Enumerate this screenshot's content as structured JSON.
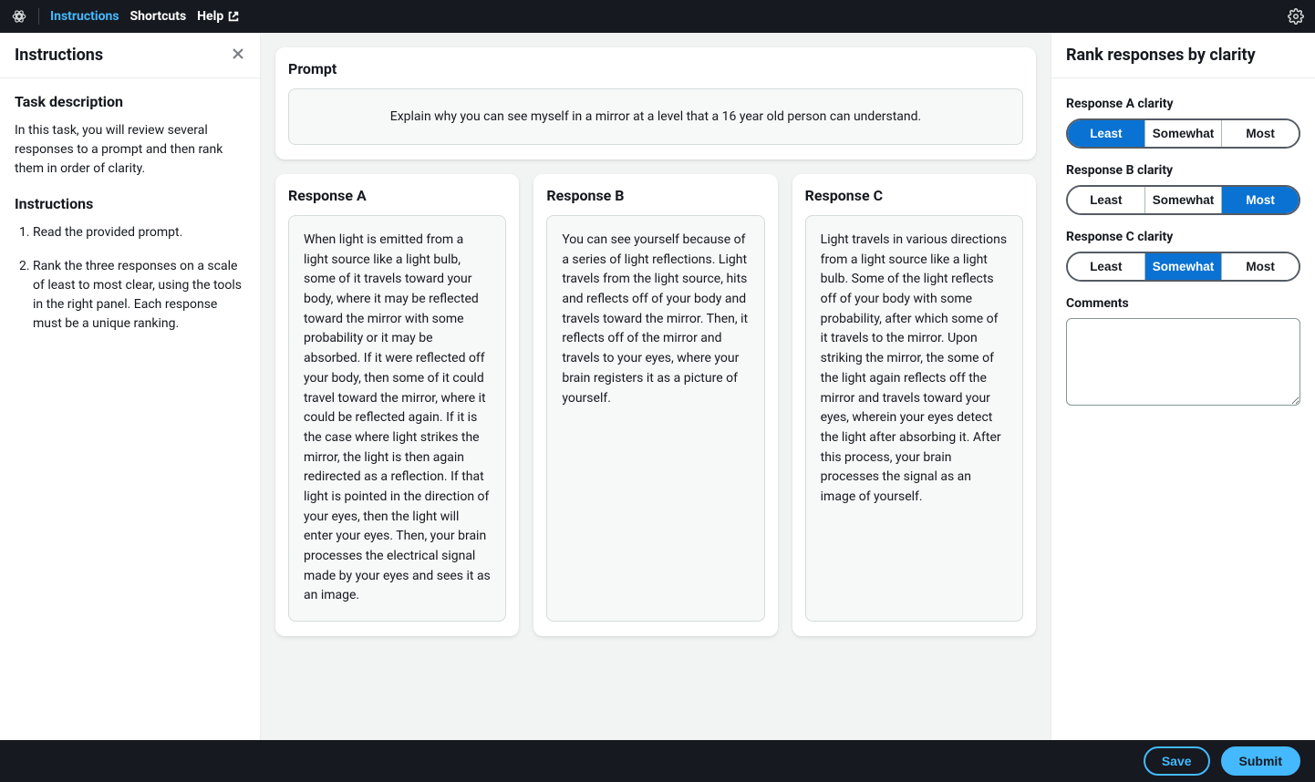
{
  "topbar": {
    "nav": {
      "instructions": "Instructions",
      "shortcuts": "Shortcuts",
      "help": "Help"
    }
  },
  "left": {
    "title": "Instructions",
    "task_heading": "Task description",
    "task_text": "In this task, you will review several responses to a prompt and then rank them in order of clarity.",
    "instr_heading": "Instructions",
    "steps": [
      "Read the provided prompt.",
      "Rank the three responses on a scale of least to most clear, using the tools in the right panel. Each response must be a unique ranking."
    ]
  },
  "center": {
    "prompt_label": "Prompt",
    "prompt_text": "Explain why you can see myself in a mirror at a level that a 16 year old person can understand.",
    "responses": {
      "a": {
        "label": "Response A",
        "text": "When light is emitted from a light source like a light bulb, some of it travels toward your body, where it may be reflected toward the mirror with some probability or it may be absorbed. If it were reflected off your body, then some of it could travel toward the mirror, where it could be reflected again. If it is the case where light strikes the mirror, the light is then again redirected as a reflection. If that light is pointed in the direction of your eyes, then the light will enter your eyes. Then, your brain processes the electrical signal made by your eyes and sees it as an image."
      },
      "b": {
        "label": "Response B",
        "text": "You can see yourself because of a series of light reflections. Light travels from the light source, hits and reflects off of your body and travels toward the mirror. Then, it reflects off of the mirror and travels to your eyes, where your brain registers it as a picture of yourself."
      },
      "c": {
        "label": "Response C",
        "text": "Light travels in various directions from a light source like a light bulb. Some of the light reflects off of your body with some probability, after which some of it travels to the mirror. Upon striking the mirror, the some of the light again reflects off the mirror and travels toward your eyes, wherein your eyes detect the light after absorbing it. After this process, your brain processes the signal as an image of yourself."
      }
    }
  },
  "right": {
    "title": "Rank responses by clarity",
    "options": {
      "least": "Least",
      "somewhat": "Somewhat",
      "most": "Most"
    },
    "fields": {
      "a_label": "Response A clarity",
      "b_label": "Response B clarity",
      "c_label": "Response C clarity"
    },
    "selected": {
      "a": "least",
      "b": "most",
      "c": "somewhat"
    },
    "comments_label": "Comments",
    "comments_value": ""
  },
  "bottombar": {
    "save": "Save",
    "submit": "Submit"
  }
}
